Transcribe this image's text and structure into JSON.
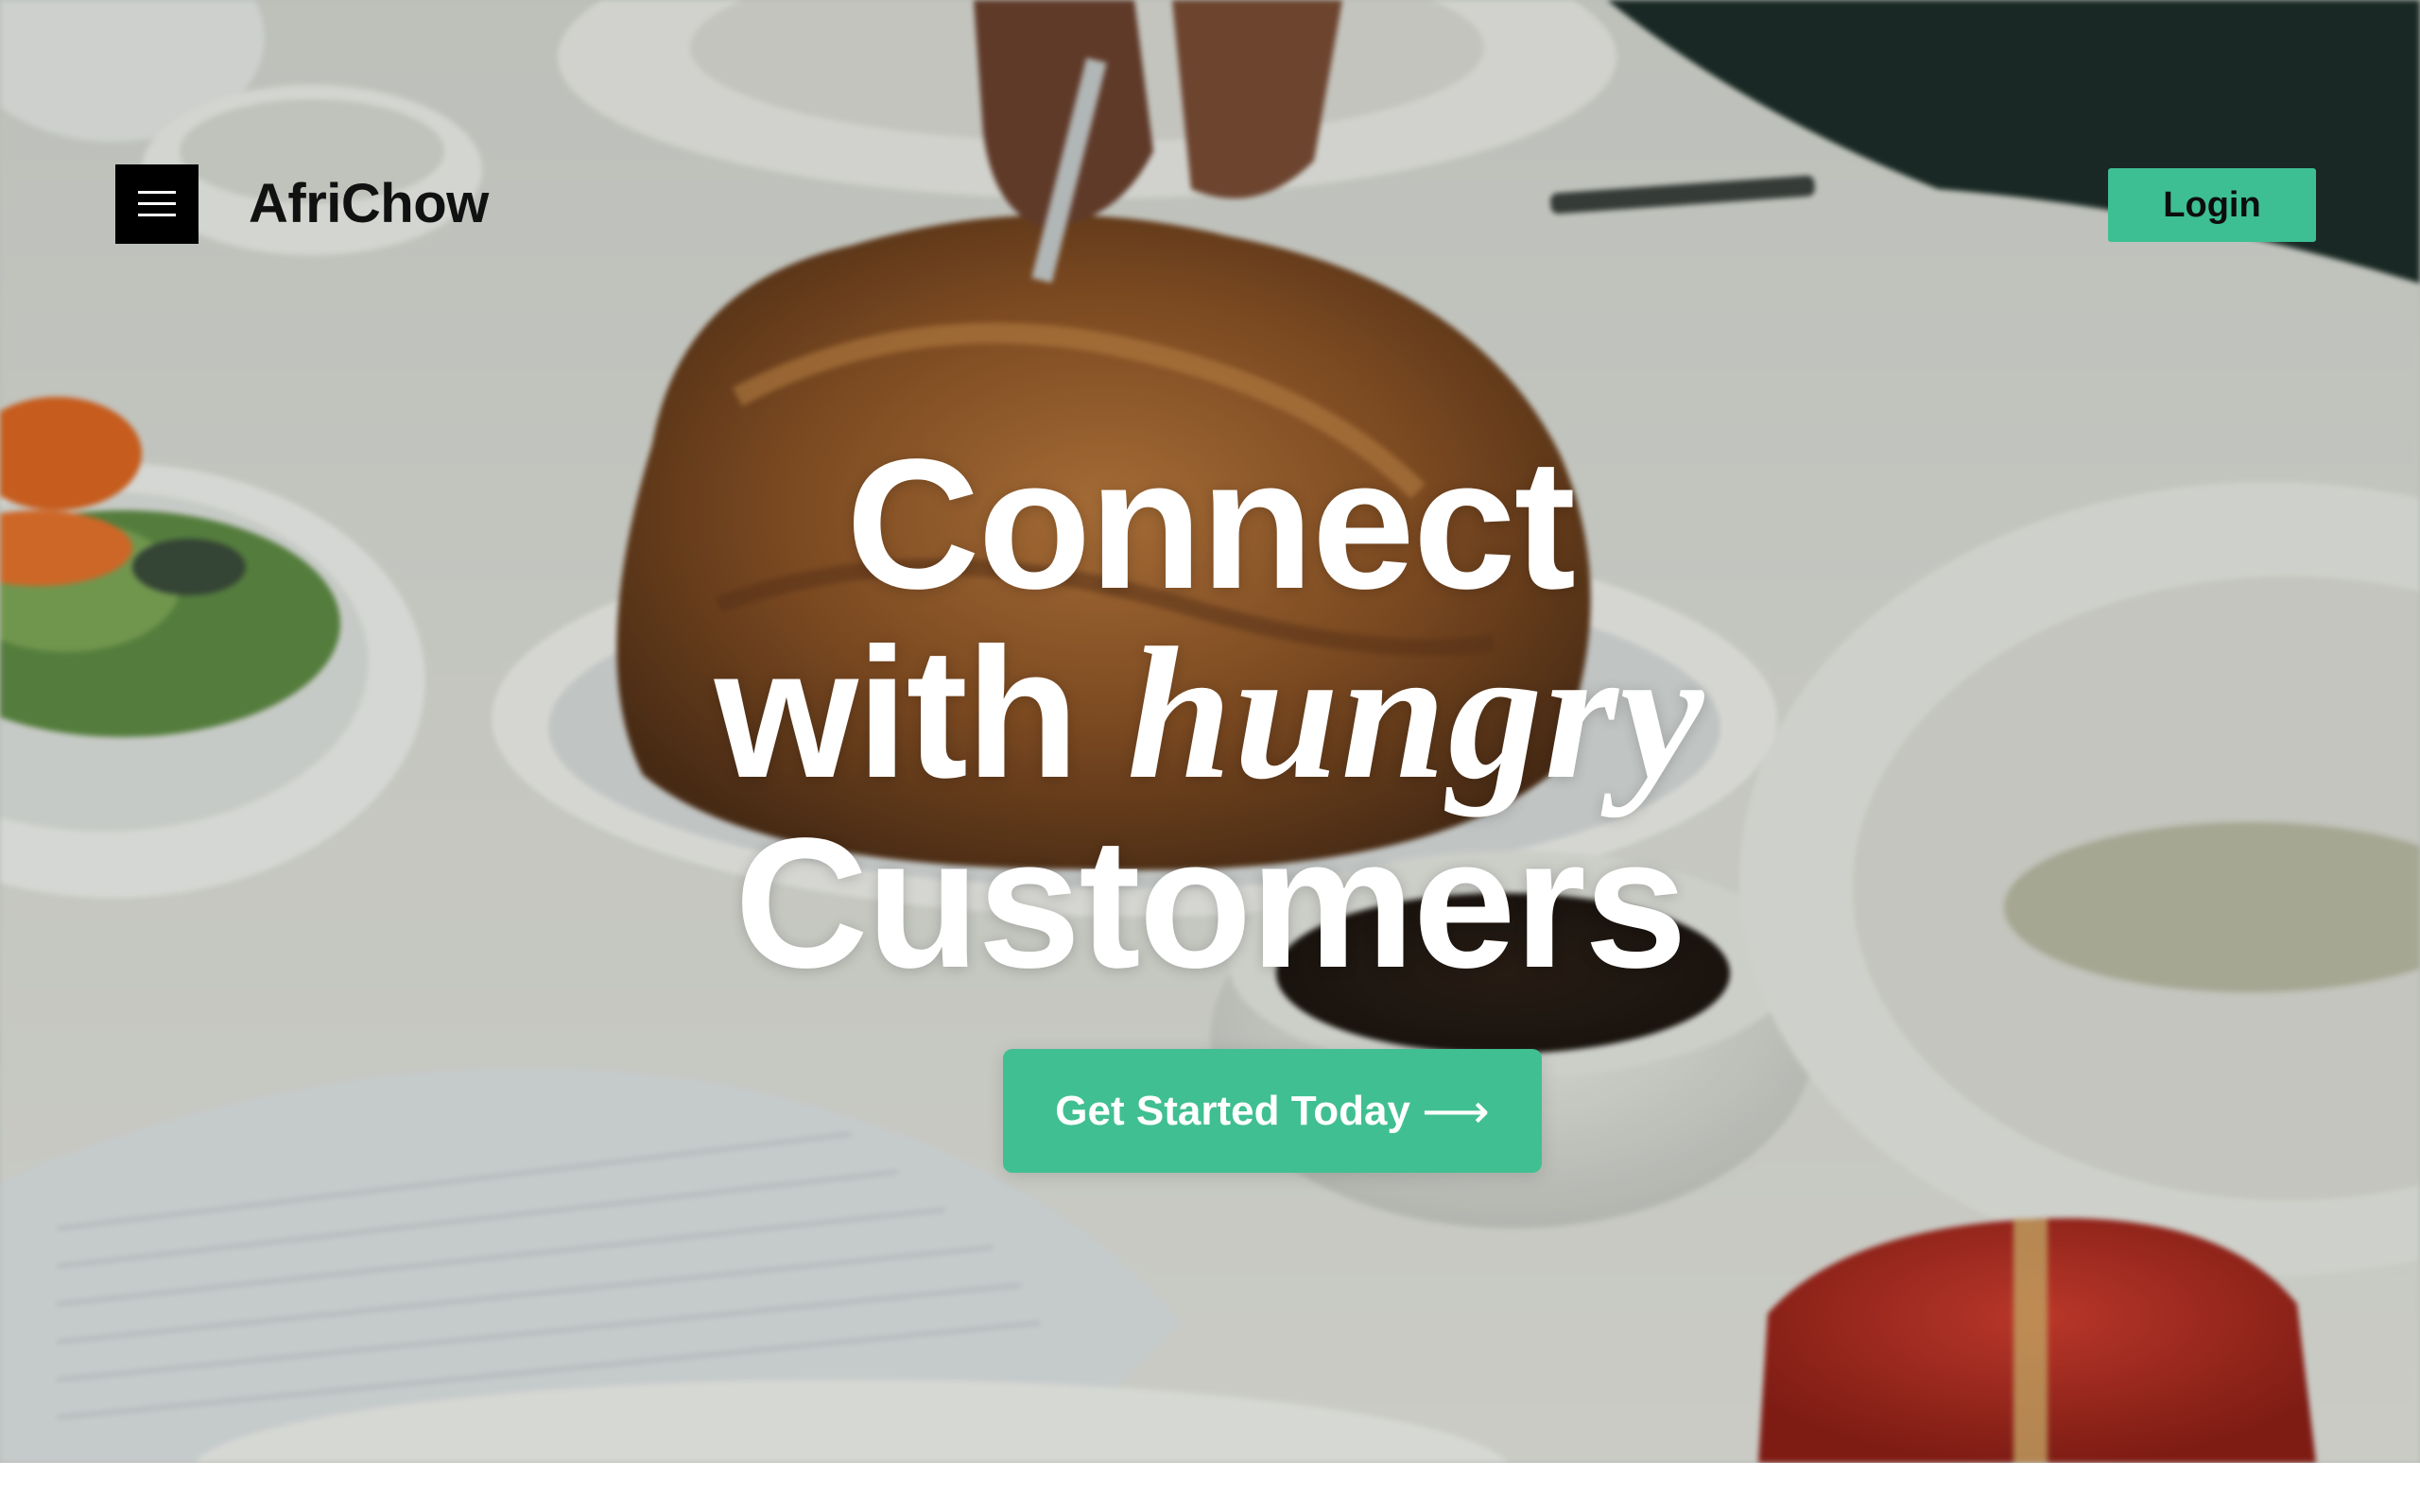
{
  "header": {
    "logo_text": "AfriChow",
    "login_label": "Login",
    "menu_icon": "hamburger-menu-icon"
  },
  "hero": {
    "headline_line1": "Connect",
    "headline_line2_prefix": "with ",
    "headline_line2_accent": "hungry",
    "headline_line3": "Customers",
    "cta_label": "Get Started Today",
    "cta_icon": "arrow-right-icon",
    "background_image": "roast-chicken-dinner-table-photo"
  },
  "colors": {
    "accent": "#40bf92",
    "menu_button": "#000000",
    "headline_text": "#ffffff"
  }
}
